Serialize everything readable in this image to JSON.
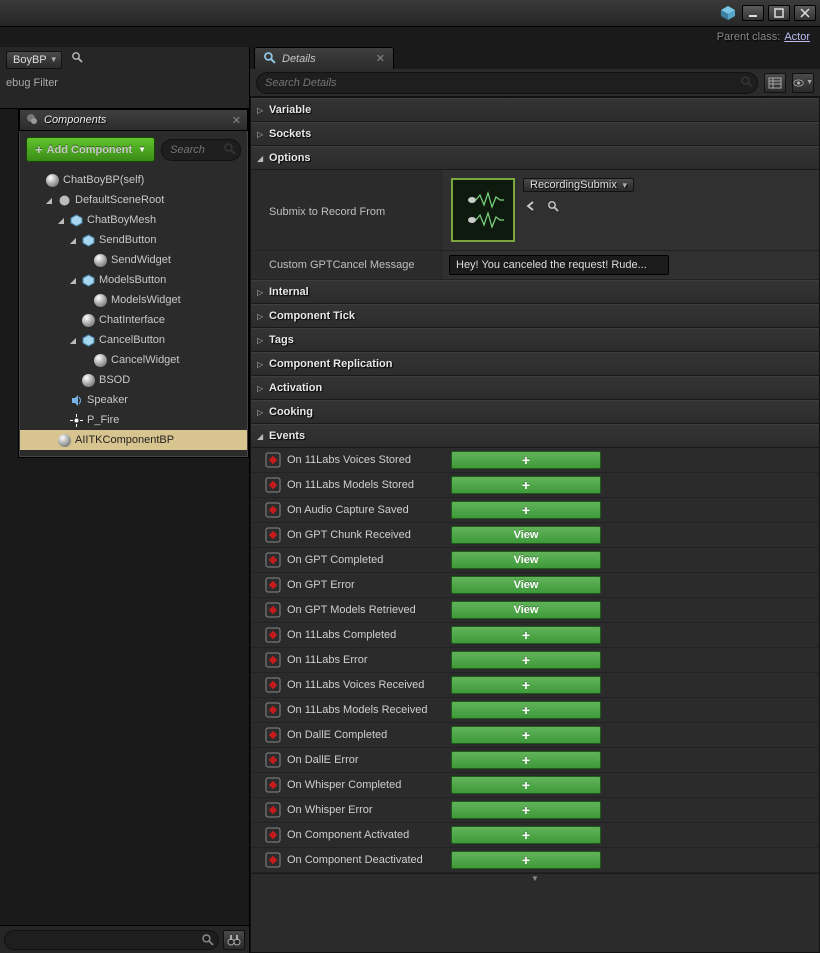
{
  "header": {
    "parent_class_label": "Parent class:",
    "parent_class_link": "Actor"
  },
  "stripA": {
    "dropdown": "BoyBP",
    "debug_filter": "ebug Filter"
  },
  "components_panel": {
    "title": "Components",
    "add_button": "Add Component",
    "search_placeholder": "Search",
    "tree": [
      {
        "depth": 0,
        "kind": "root",
        "label": "ChatBoyBP(self)"
      },
      {
        "depth": 1,
        "kind": "scene",
        "label": "DefaultSceneRoot",
        "exp": true
      },
      {
        "depth": 2,
        "kind": "mesh",
        "label": "ChatBoyMesh",
        "exp": true
      },
      {
        "depth": 3,
        "kind": "widget",
        "label": "SendButton",
        "exp": true
      },
      {
        "depth": 4,
        "kind": "sphere",
        "label": "SendWidget"
      },
      {
        "depth": 3,
        "kind": "widget",
        "label": "ModelsButton",
        "exp": true
      },
      {
        "depth": 4,
        "kind": "sphere",
        "label": "ModelsWidget"
      },
      {
        "depth": 3,
        "kind": "sphere",
        "label": "ChatInterface"
      },
      {
        "depth": 3,
        "kind": "widget",
        "label": "CancelButton",
        "exp": true
      },
      {
        "depth": 4,
        "kind": "sphere",
        "label": "CancelWidget"
      },
      {
        "depth": 3,
        "kind": "sphere",
        "label": "BSOD"
      },
      {
        "depth": 2,
        "kind": "speaker",
        "label": "Speaker"
      },
      {
        "depth": 2,
        "kind": "particle",
        "label": "P_Fire"
      },
      {
        "depth": 1,
        "kind": "sphere",
        "label": "AIITKComponentBP",
        "selected": true
      }
    ]
  },
  "details_panel": {
    "title": "Details",
    "search_placeholder": "Search Details",
    "categories_collapsed": [
      "Variable",
      "Sockets"
    ],
    "options": {
      "label": "Options",
      "submix_label": "Submix to Record From",
      "submix_value": "RecordingSubmix",
      "cancel_msg_label": "Custom GPTCancel Message",
      "cancel_msg_value": "Hey! You canceled the request! Rude..."
    },
    "categories_collapsed2": [
      "Internal",
      "Component Tick",
      "Tags",
      "Component Replication",
      "Activation",
      "Cooking"
    ],
    "events_label": "Events",
    "events": [
      {
        "label": "On 11Labs Voices Stored",
        "action": "add"
      },
      {
        "label": "On 11Labs Models Stored",
        "action": "add"
      },
      {
        "label": "On Audio Capture Saved",
        "action": "add"
      },
      {
        "label": "On GPT Chunk Received",
        "action": "View"
      },
      {
        "label": "On GPT Completed",
        "action": "View"
      },
      {
        "label": "On GPT Error",
        "action": "View"
      },
      {
        "label": "On GPT Models Retrieved",
        "action": "View"
      },
      {
        "label": "On 11Labs Completed",
        "action": "add"
      },
      {
        "label": "On 11Labs Error",
        "action": "add"
      },
      {
        "label": "On 11Labs Voices Received",
        "action": "add"
      },
      {
        "label": "On 11Labs Models Received",
        "action": "add"
      },
      {
        "label": "On DallE Completed",
        "action": "add"
      },
      {
        "label": "On DallE Error",
        "action": "add"
      },
      {
        "label": "On Whisper Completed",
        "action": "add"
      },
      {
        "label": "On Whisper Error",
        "action": "add"
      },
      {
        "label": "On Component Activated",
        "action": "add"
      },
      {
        "label": "On Component Deactivated",
        "action": "add"
      }
    ]
  }
}
